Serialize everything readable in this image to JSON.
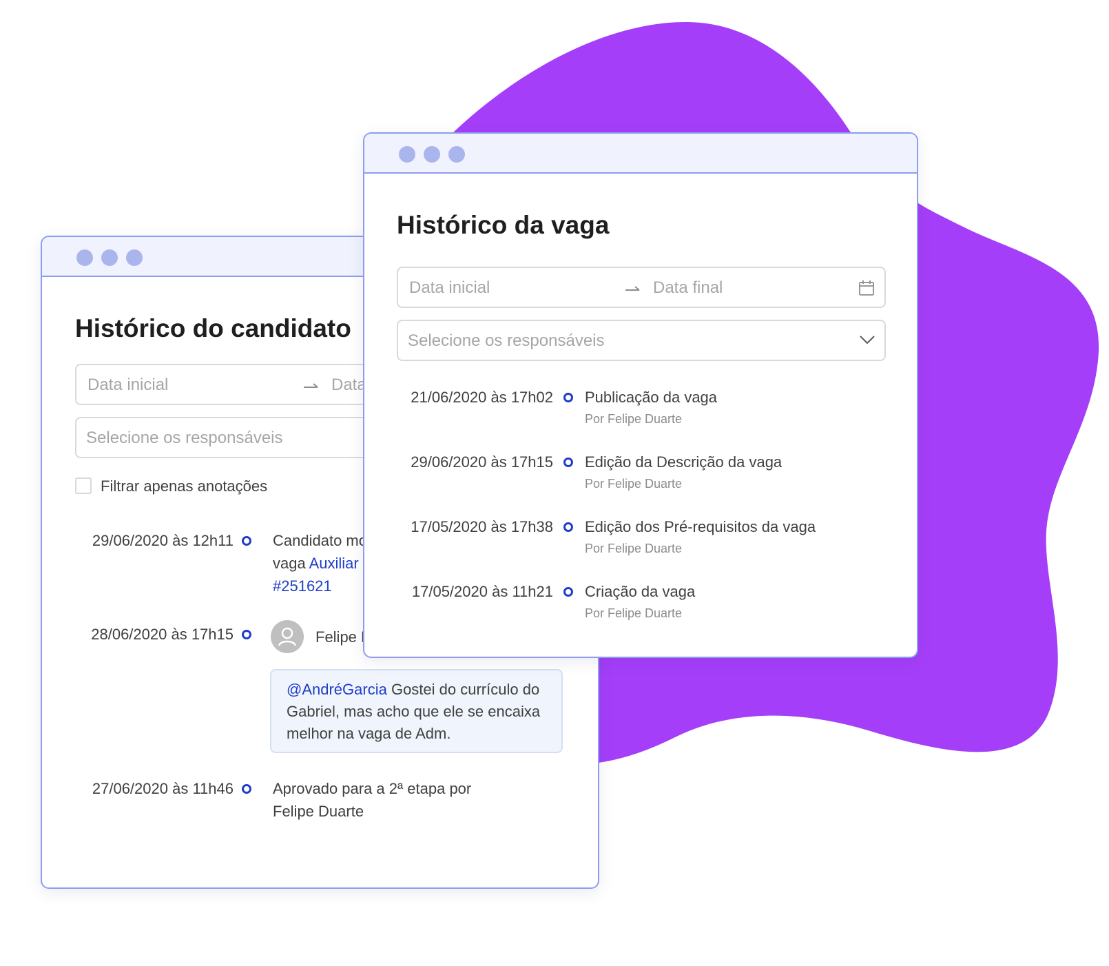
{
  "colors": {
    "blob": "#a53ef8",
    "window_border": "#8e9cf0",
    "titlebar": "#f0f3fd",
    "accent": "#1e3ec8"
  },
  "candidate_window": {
    "title": "Histórico do candidato",
    "date_start_placeholder": "Data inicial",
    "date_end_placeholder": "Data",
    "responsible_placeholder": "Selecione os responsáveis",
    "filter_label": "Filtrar apenas anotações",
    "timeline": [
      {
        "date": "29/06/2020 às 12h11",
        "line1": "Candidato mo",
        "line2_prefix": "vaga ",
        "link1": "Auxiliar",
        "link2": "#251621"
      },
      {
        "date": "28/06/2020 às 17h15",
        "author": "Felipe D",
        "mention": "@AndréGarcia",
        "comment": " Gostei do currículo do Gabriel, mas acho que ele se encaixa melhor na vaga de Adm."
      },
      {
        "date": "27/06/2020 às 11h46",
        "line1": "Aprovado para a 2ª etapa por",
        "line2": "Felipe Duarte"
      }
    ]
  },
  "job_window": {
    "title": "Histórico da vaga",
    "date_start_placeholder": "Data inicial",
    "date_end_placeholder": "Data final",
    "responsible_placeholder": "Selecione os responsáveis",
    "timeline": [
      {
        "date": "21/06/2020 às 17h02",
        "event": "Publicação da vaga",
        "by": "Por Felipe Duarte"
      },
      {
        "date": "29/06/2020 às 17h15",
        "event": "Edição da Descrição da vaga",
        "by": "Por Felipe Duarte"
      },
      {
        "date": "17/05/2020 às 17h38",
        "event": "Edição dos Pré-requisitos da vaga",
        "by": "Por Felipe Duarte"
      },
      {
        "date": "17/05/2020 às 11h21",
        "event": "Criação da vaga",
        "by": "Por Felipe Duarte"
      }
    ]
  },
  "icons": {
    "arrow": "right-arrow-icon",
    "calendar": "calendar-icon",
    "dropdown": "chevron-down-icon",
    "avatar": "user-icon"
  }
}
